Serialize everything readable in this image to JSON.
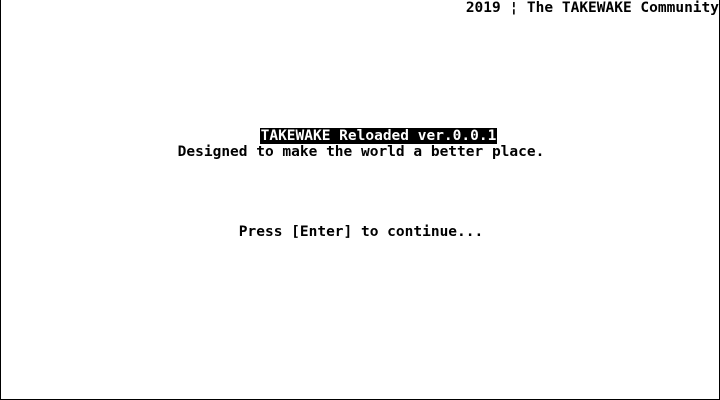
{
  "header": {
    "copyright": "2019 ¦ The TAKEWAKE Community"
  },
  "main": {
    "title": "TAKEWAKE Reloaded ver.0.0.1",
    "tagline": "Designed to make the world a better place.",
    "prompt": "Press [Enter] to continue..."
  },
  "colors": {
    "background": "#ffffff",
    "text": "#000000",
    "highlight_background": "#000000",
    "highlight_text": "#ffffff"
  }
}
